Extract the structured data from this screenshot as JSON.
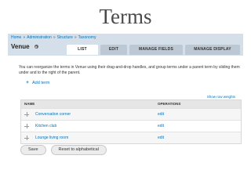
{
  "slide": {
    "title": "Terms"
  },
  "breadcrumb": {
    "items": [
      "Home",
      "Administration",
      "Structure",
      "Taxonomy"
    ],
    "separator": "»"
  },
  "page": {
    "title": "Venue"
  },
  "tabs": [
    {
      "label": "LIST",
      "active": true
    },
    {
      "label": "EDIT",
      "active": false
    },
    {
      "label": "MANAGE FIELDS",
      "active": false
    },
    {
      "label": "MANAGE DISPLAY",
      "active": false
    }
  ],
  "help_text": "You can reorganize the terms in Venue using their drag-and-drop handles, and group terms under a parent term by sliding them under and to the right of the parent.",
  "add_term": {
    "label": "Add term",
    "icon": "plus-icon"
  },
  "show_weights": "Show row weights",
  "table": {
    "headers": {
      "name": "NAME",
      "operations": "OPERATIONS"
    },
    "rows": [
      {
        "name": "Conversation corner",
        "operation": "edit"
      },
      {
        "name": "Kitchen club",
        "operation": "edit"
      },
      {
        "name": "Lounge living room",
        "operation": "edit"
      }
    ]
  },
  "buttons": {
    "save": "Save",
    "reset": "Reset to alphabetical"
  },
  "colors": {
    "link": "#0074bd",
    "header_bg": "#d5dfe9",
    "tab_inactive": "#bcc8d3"
  }
}
